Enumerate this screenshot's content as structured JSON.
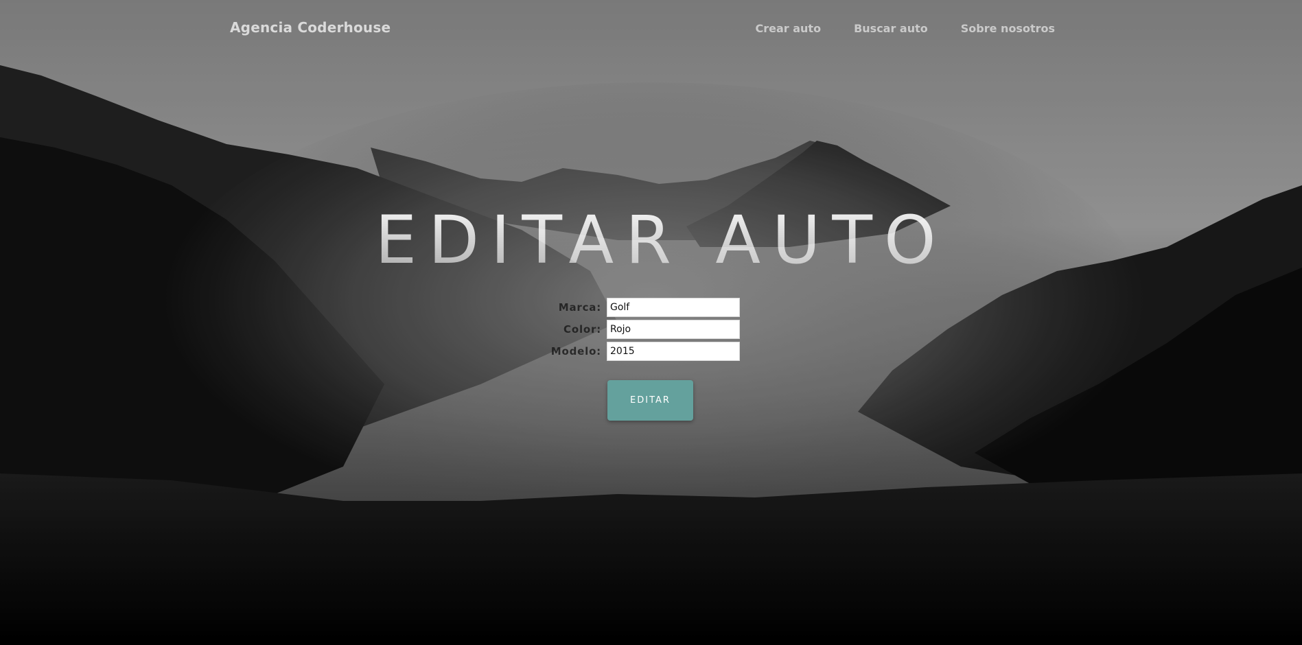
{
  "navbar": {
    "brand": "Agencia Coderhouse",
    "links": [
      {
        "label": "Crear auto"
      },
      {
        "label": "Buscar auto"
      },
      {
        "label": "Sobre nosotros"
      }
    ]
  },
  "hero": {
    "title": "EDITAR AUTO"
  },
  "form": {
    "fields": [
      {
        "label": "Marca:",
        "value": "Golf"
      },
      {
        "label": "Color:",
        "value": "Rojo"
      },
      {
        "label": "Modelo:",
        "value": "2015"
      }
    ],
    "submit_label": "EDITAR"
  },
  "colors": {
    "accent": "#64a19d",
    "background": "#7c7c7c"
  }
}
